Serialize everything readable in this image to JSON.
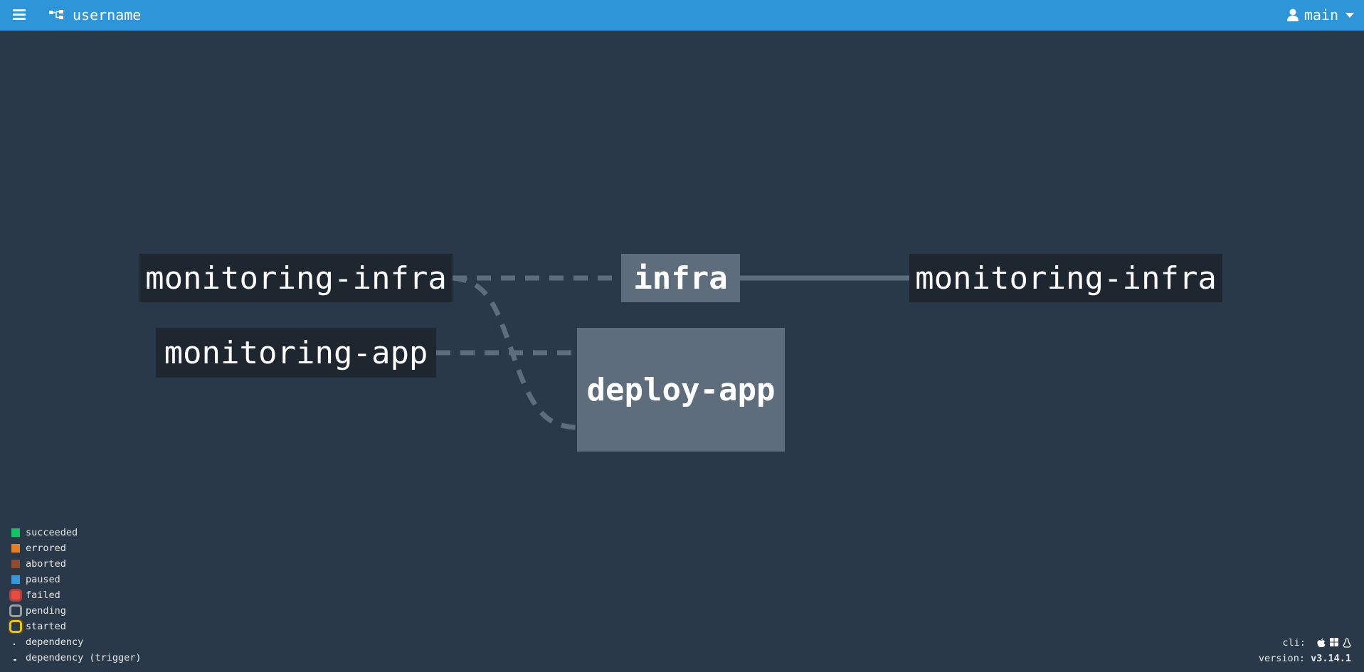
{
  "topbar": {
    "pipeline_name": "username",
    "user": "main"
  },
  "graph": {
    "inputs": [
      {
        "label": "monitoring-infra"
      },
      {
        "label": "monitoring-app"
      }
    ],
    "jobs": [
      {
        "label": "infra"
      },
      {
        "label": "deploy-app"
      }
    ],
    "outputs": [
      {
        "label": "monitoring-infra"
      }
    ]
  },
  "legend": [
    {
      "label": "succeeded",
      "color": "#11c560"
    },
    {
      "label": "errored",
      "color": "#e67e22"
    },
    {
      "label": "aborted",
      "color": "#8f4b2d"
    },
    {
      "label": "paused",
      "color": "#3498db"
    },
    {
      "label": "failed",
      "color": "#e74c3c"
    },
    {
      "label": "pending",
      "color": "#9b9fa3"
    },
    {
      "label": "started",
      "color": "#f1c40f"
    },
    {
      "label": "dependency"
    },
    {
      "label": "dependency (trigger)"
    }
  ],
  "footer": {
    "cli_label": "cli:",
    "version_label": "version:",
    "version": "v3.14.1",
    "cli_icons": [
      "apple-icon",
      "windows-icon",
      "linux-icon"
    ]
  }
}
